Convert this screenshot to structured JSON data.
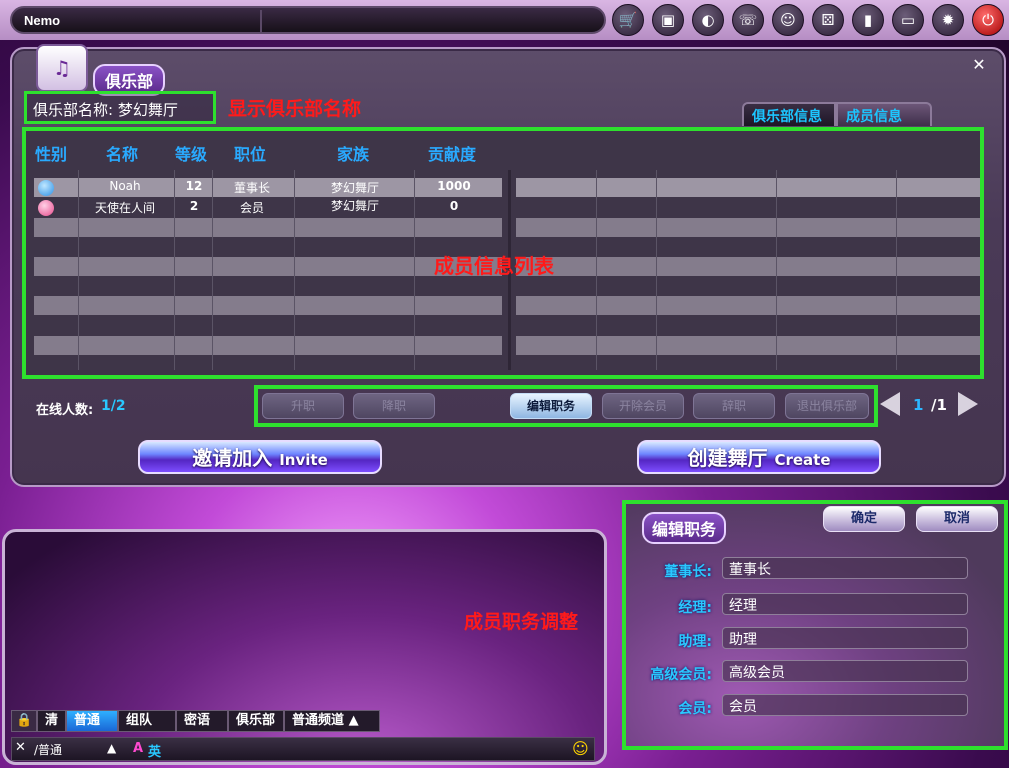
{
  "topbar": {
    "username": "Nemo",
    "icons": [
      {
        "name": "shop-cart-icon",
        "glyph": "🛒"
      },
      {
        "name": "photo-board-icon",
        "glyph": "▣"
      },
      {
        "name": "planet-icon",
        "glyph": "◐"
      },
      {
        "name": "phone-icon",
        "glyph": "☏"
      },
      {
        "name": "friend-icon",
        "glyph": "☺"
      },
      {
        "name": "dice-icon",
        "glyph": "⚄"
      },
      {
        "name": "podium-icon",
        "glyph": "▮"
      },
      {
        "name": "folder-icon",
        "glyph": "▭"
      },
      {
        "name": "settings-icon",
        "glyph": "✹"
      },
      {
        "name": "power-icon",
        "glyph": "⏻"
      }
    ]
  },
  "club": {
    "tab_title": "俱乐部",
    "name_label": "俱乐部名称:",
    "name_value": "梦幻舞厅",
    "name_annotation": "显示俱乐部名称",
    "tabs": [
      "俱乐部信息",
      "成员信息"
    ],
    "columns": [
      "性别",
      "名称",
      "等级",
      "职位",
      "家族",
      "贡献度"
    ],
    "members": [
      {
        "gender": "male",
        "name": "Noah",
        "level": "12",
        "role": "董事长",
        "family": "梦幻舞厅",
        "contribution": "1000"
      },
      {
        "gender": "female",
        "name": "天使在人间",
        "level": "2",
        "role": "会员",
        "family": "梦幻舞厅",
        "contribution": "0"
      }
    ],
    "list_annotation": "成员信息列表",
    "online_label": "在线人数:",
    "online_value": "1/2",
    "action_buttons": [
      "升职",
      "降职",
      "编辑职务",
      "开除会员",
      "辞职",
      "退出俱乐部"
    ],
    "page_current": "1",
    "page_total": "/1",
    "invite_button": {
      "cn": "邀请加入",
      "en": "Invite"
    },
    "create_button": {
      "cn": "创建舞厅",
      "en": "Create"
    }
  },
  "chat": {
    "annotation": "成员职务调整",
    "tabs": [
      "清",
      "普通",
      "组队",
      "密语",
      "俱乐部",
      "普通频道"
    ],
    "channel": "/普通",
    "input_mode_a": "A",
    "input_mode_b": "英"
  },
  "edit_roles": {
    "title": "编辑职务",
    "confirm": "确定",
    "cancel": "取消",
    "roles": [
      {
        "label": "董事长:",
        "value": "董事长"
      },
      {
        "label": "经理:",
        "value": "经理"
      },
      {
        "label": "助理:",
        "value": "助理"
      },
      {
        "label": "高级会员:",
        "value": "高级会员"
      },
      {
        "label": "会员:",
        "value": "会员"
      }
    ]
  }
}
